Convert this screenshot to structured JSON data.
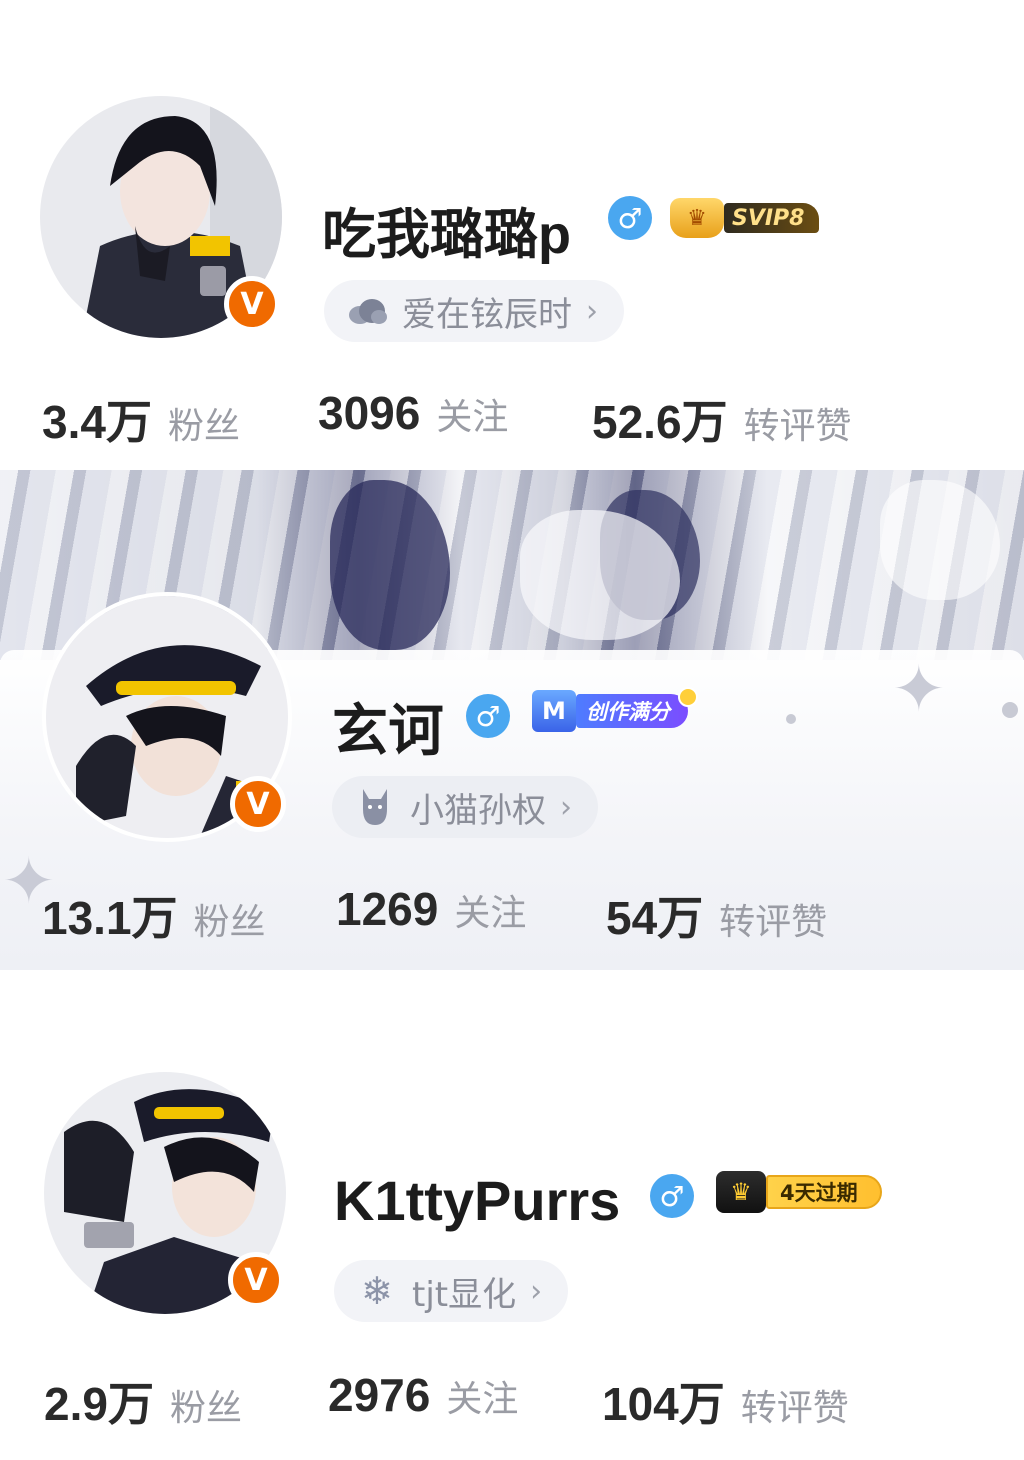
{
  "profiles": [
    {
      "name": "吃我璐璐p",
      "gender_symbol": "♂",
      "badge_label": "SVIP8",
      "badge_crown": "♛",
      "pill_text": "爱在铉辰时",
      "pill_icon": "cloud-icon",
      "stats": [
        {
          "value": "3.4万",
          "label": "粉丝"
        },
        {
          "value": "3096",
          "label": "关注"
        },
        {
          "value": "52.6万",
          "label": "转评赞"
        }
      ]
    },
    {
      "name": "玄诃",
      "gender_symbol": "♂",
      "badge_label": "创作满分",
      "badge_icon_text": "M",
      "pill_text": "小猫孙权",
      "pill_icon": "cat-icon",
      "stats": [
        {
          "value": "13.1万",
          "label": "粉丝"
        },
        {
          "value": "1269",
          "label": "关注"
        },
        {
          "value": "54万",
          "label": "转评赞"
        }
      ]
    },
    {
      "name": "K1ttyPurrs",
      "gender_symbol": "♂",
      "badge_label": "4天过期",
      "badge_crown": "♛",
      "pill_text": "tjt显化",
      "pill_icon": "snowflake-icon",
      "stats": [
        {
          "value": "2.9万",
          "label": "粉丝"
        },
        {
          "value": "2976",
          "label": "关注"
        },
        {
          "value": "104万",
          "label": "转评赞"
        }
      ]
    }
  ],
  "verified_badge_letter": "V",
  "chevron": "›",
  "colors": {
    "verified_orange": "#f06a00",
    "gender_blue": "#4aa7f0",
    "pill_bg": "#f2f3f7",
    "stat_label": "#9a9ca4"
  }
}
